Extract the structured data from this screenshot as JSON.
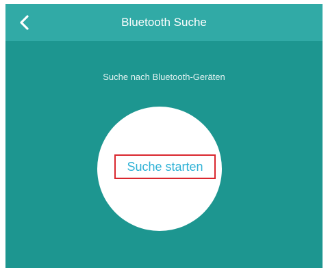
{
  "header": {
    "title": "Bluetooth Suche",
    "back_icon": "chevron-left-icon"
  },
  "main": {
    "subtitle": "Suche nach Bluetooth-Geräten",
    "start_button_label": "Suche starten"
  },
  "colors": {
    "background": "#1d9690",
    "header": "#31aaa6",
    "circle": "#ffffff",
    "button_text": "#2fb2d6",
    "highlight_border": "#d9262d"
  }
}
